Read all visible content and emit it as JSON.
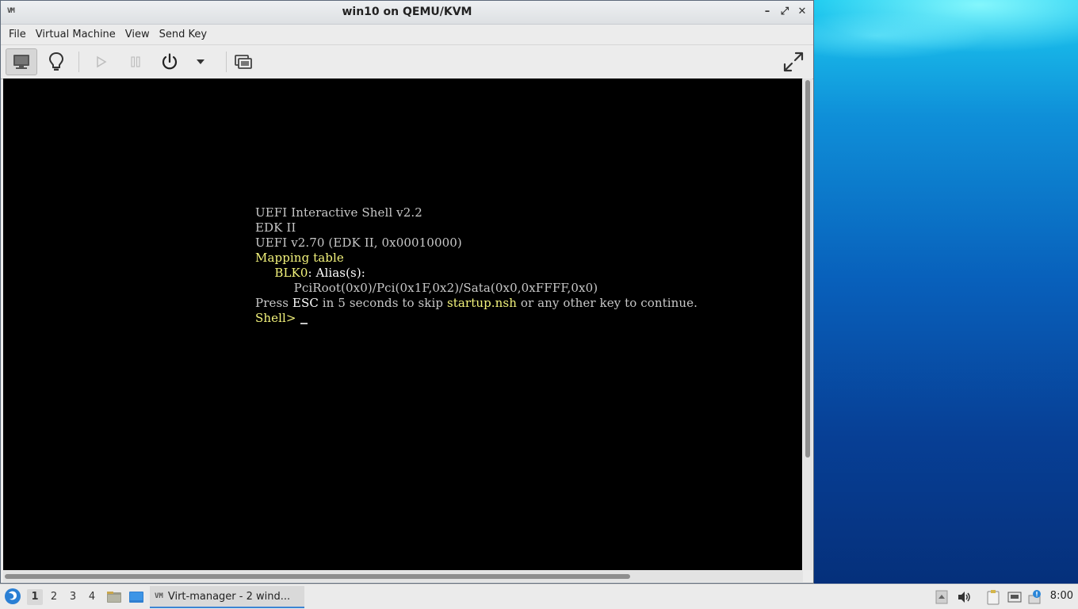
{
  "window": {
    "title": "win10 on QEMU/KVM",
    "app_icon_text": "VM",
    "controls": {
      "minimize": "–",
      "maximize": "⤢",
      "close": "✕"
    }
  },
  "menubar": {
    "items": [
      "File",
      "Virtual Machine",
      "View",
      "Send Key"
    ]
  },
  "toolbar": {
    "buttons": [
      "console-view",
      "details-view",
      "run",
      "pause",
      "shutdown",
      "shutdown-menu",
      "snapshots",
      "fullscreen"
    ]
  },
  "console": {
    "line1": "UEFI Interactive Shell v2.2",
    "line2": "EDK II",
    "line3": "UEFI v2.70 (EDK II, 0x00010000)",
    "line4": "Mapping table",
    "line5_indent": "     ",
    "line5_dev": "BLK0",
    "line5_rest": ": Alias(s):",
    "line6": "          PciRoot(0x0)/Pci(0x1F,0x2)/Sata(0x0,0xFFFF,0x0)",
    "line7_a": "Press ",
    "line7_b": "ESC",
    "line7_c": " in 5 seconds to skip ",
    "line7_d": "startup.nsh",
    "line7_e": " or any other key to continue.",
    "prompt": "Shell> "
  },
  "taskbar": {
    "workspaces": [
      "1",
      "2",
      "3",
      "4"
    ],
    "active_workspace": "1",
    "task_label": "Virt-manager - 2 wind...",
    "clock": "8:00"
  }
}
